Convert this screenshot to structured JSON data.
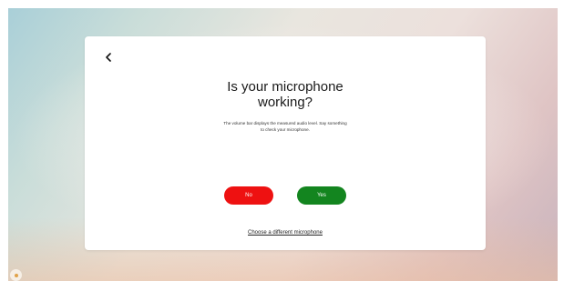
{
  "dialog": {
    "back_icon": "chevron-left-icon",
    "title_line1": "Is your microphone",
    "title_line2": "working?",
    "description_line1": "The volume bar displays the measured audio level. Say something",
    "description_line2": "to check your microphone.",
    "no_label": "No",
    "yes_label": "Yes",
    "alt_link_label": "Choose a different microphone"
  },
  "colors": {
    "no_button": "#ee1111",
    "yes_button": "#13851f",
    "card": "#ffffff"
  },
  "corner_widget_icon": "avatar-icon"
}
